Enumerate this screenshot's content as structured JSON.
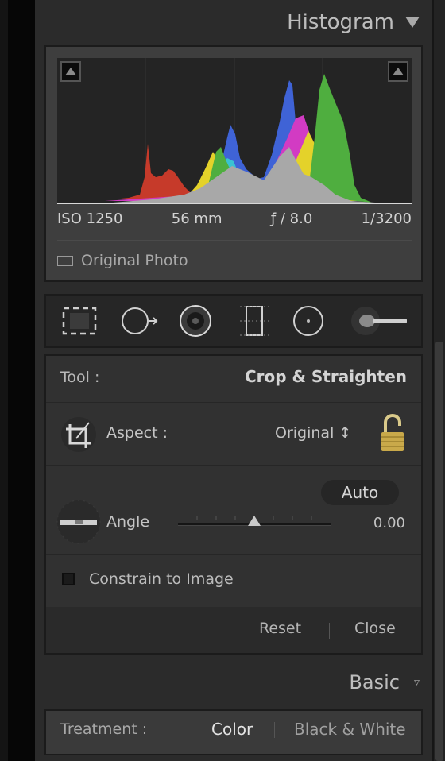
{
  "histogram": {
    "title": "Histogram",
    "exif": {
      "iso": "ISO 1250",
      "focal": "56 mm",
      "aperture": "ƒ / 8.0",
      "shutter": "1/3200"
    },
    "original_photo_label": "Original Photo"
  },
  "tool_strip": {
    "tools": [
      "crop-overlay-icon",
      "spot-removal-icon",
      "red-eye-icon",
      "graduated-filter-icon",
      "radial-filter-icon",
      "adjustment-brush-icon"
    ]
  },
  "crop": {
    "tool_label": "Tool :",
    "tool_value": "Crop & Straighten",
    "aspect_label": "Aspect :",
    "aspect_value": "Original ↕",
    "auto_label": "Auto",
    "angle_label": "Angle",
    "angle_value": "0.00",
    "angle_position": 0.5,
    "constrain_label": "Constrain to Image",
    "constrain_checked": false,
    "reset_label": "Reset",
    "close_label": "Close"
  },
  "basic": {
    "title": "Basic",
    "treatment_label": "Treatment :",
    "color_label": "Color",
    "bw_label": "Black & White"
  }
}
